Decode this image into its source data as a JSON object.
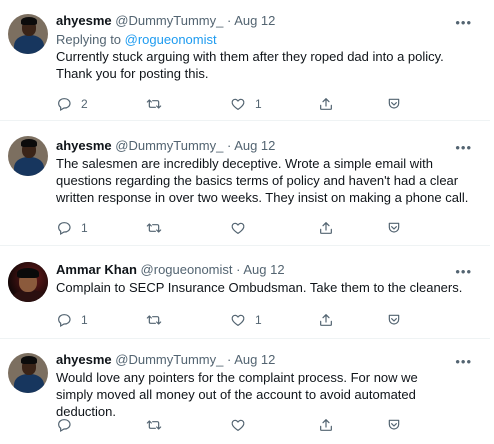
{
  "tweets": [
    {
      "name": "ahyesme",
      "handle": "@DummyTummy_",
      "time": "Aug 12",
      "reply_prefix": "Replying to ",
      "reply_to": "@rogueonomist",
      "text": "Currently stuck arguing with them after they roped dad into a policy. Thank you for posting this.",
      "reply_count": "2",
      "retweet_count": "",
      "like_count": "1"
    },
    {
      "name": "ahyesme",
      "handle": "@DummyTummy_",
      "time": "Aug 12",
      "text": "The salesmen are incredibly deceptive. Wrote a simple email with questions regarding the basics terms of policy and haven't had a clear written response in over two weeks. They insist on making a phone call.",
      "reply_count": "1",
      "retweet_count": "",
      "like_count": ""
    },
    {
      "name": "Ammar Khan",
      "handle": "@rogueonomist",
      "time": "Aug 12",
      "text": "Complain to SECP Insurance Ombudsman. Take them to the cleaners.",
      "reply_count": "1",
      "retweet_count": "",
      "like_count": "1"
    },
    {
      "name": "ahyesme",
      "handle": "@DummyTummy_",
      "time": "Aug 12",
      "text": "Would love any pointers for the complaint process. For now we simply moved all money out of the account to avoid automated deduction.",
      "reply_count": "",
      "retweet_count": "",
      "like_count": ""
    }
  ],
  "separator": " · ",
  "more_label": "•••",
  "icons": {
    "reply": "reply-icon",
    "retweet": "retweet-icon",
    "like": "heart-icon",
    "share": "share-icon",
    "tip": "tip-icon",
    "more": "more-icon"
  },
  "colors": {
    "link": "#1d9bf0",
    "muted": "#536471",
    "text": "#0f1419"
  }
}
